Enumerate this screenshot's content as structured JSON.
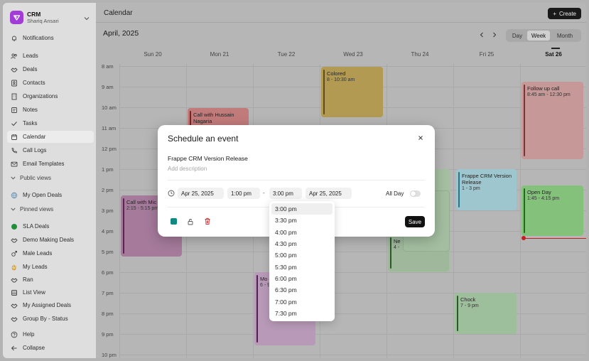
{
  "brand": {
    "name": "CRM",
    "user": "Shariq Ansari"
  },
  "sidebar": {
    "top_items": [
      {
        "label": "Notifications",
        "icon": "bell-icon"
      }
    ],
    "items": [
      {
        "label": "Leads",
        "icon": "users-icon"
      },
      {
        "label": "Deals",
        "icon": "handshake-icon"
      },
      {
        "label": "Contacts",
        "icon": "contact-icon"
      },
      {
        "label": "Organizations",
        "icon": "building-icon"
      },
      {
        "label": "Notes",
        "icon": "note-icon"
      },
      {
        "label": "Tasks",
        "icon": "check-icon"
      },
      {
        "label": "Calendar",
        "icon": "calendar-icon"
      },
      {
        "label": "Call Logs",
        "icon": "phone-icon"
      },
      {
        "label": "Email Templates",
        "icon": "mail-icon"
      }
    ],
    "public_views_label": "Public views",
    "public_views": [
      {
        "label": "My Open Deals",
        "icon": "globe-icon"
      }
    ],
    "pinned_views_label": "Pinned views",
    "pinned_views": [
      {
        "label": "SLA Deals",
        "icon": "green-circle-icon"
      },
      {
        "label": "Demo Making Deals",
        "icon": "handshake-icon"
      },
      {
        "label": "Male Leads",
        "icon": "male-icon"
      },
      {
        "label": "My Leads",
        "icon": "hand-icon"
      },
      {
        "label": "Ran",
        "icon": "handshake-icon"
      },
      {
        "label": "List View",
        "icon": "list-icon"
      },
      {
        "label": "My Assigned Deals",
        "icon": "handshake-icon"
      },
      {
        "label": "Group By - Status",
        "icon": "handshake-icon"
      }
    ],
    "bottom_items": [
      {
        "label": "Help",
        "icon": "help-icon"
      },
      {
        "label": "Collapse",
        "icon": "collapse-icon"
      }
    ]
  },
  "header": {
    "title": "Calendar",
    "create_label": "Create"
  },
  "calendar": {
    "month_label": "April, 2025",
    "views": [
      "Day",
      "Week",
      "Month"
    ],
    "active_view": "Week",
    "days": [
      "Sun 20",
      "Mon 21",
      "Tue 22",
      "Wed 23",
      "Thu 24",
      "Fri 25",
      "Sat 26"
    ],
    "today": "Sat 26",
    "hours": [
      "8 am",
      "9 am",
      "10 am",
      "11 am",
      "12 pm",
      "1 pm",
      "2 pm",
      "3 pm",
      "4 pm",
      "5 pm",
      "6 pm",
      "7 pm",
      "8 pm",
      "9 pm",
      "10 pm"
    ],
    "events": [
      {
        "title": "Colored",
        "time": "8 - 10:30 am"
      },
      {
        "title": "Call with Hussain Nagaria",
        "time": ""
      },
      {
        "title": "Call with Mic",
        "time": "2:15 - 5:15 pm"
      },
      {
        "title": "Follow up call",
        "time": "8:45 am - 12:30 pm"
      },
      {
        "title": "Frappe CRM Version Release",
        "time": "1 - 3 pm"
      },
      {
        "title": "Open Day",
        "time": "1:45 - 4:15 pm"
      },
      {
        "title": "Mo com",
        "time": "6 - 9"
      },
      {
        "title": "Chock",
        "time": "7 - 9 pm"
      },
      {
        "title": "Ne",
        "time": "4 -"
      }
    ]
  },
  "modal": {
    "title": "Schedule an event",
    "event_title": "Frappe CRM Version Release",
    "description_placeholder": "Add description",
    "start_date": "Apr 25, 2025",
    "start_time": "1:00 pm",
    "separator": "-",
    "end_time": "3:00 pm",
    "end_date": "Apr 25, 2025",
    "all_day_label": "All Day",
    "all_day": false,
    "event_color": "#0f8a82",
    "save_label": "Save"
  },
  "time_dropdown": {
    "options": [
      "3:00 pm",
      "3:30 pm",
      "4:00 pm",
      "4:30 pm",
      "5:00 pm",
      "5:30 pm",
      "6:00 pm",
      "6:30 pm",
      "7:00 pm",
      "7:30 pm"
    ],
    "selected": "3:00 pm"
  }
}
